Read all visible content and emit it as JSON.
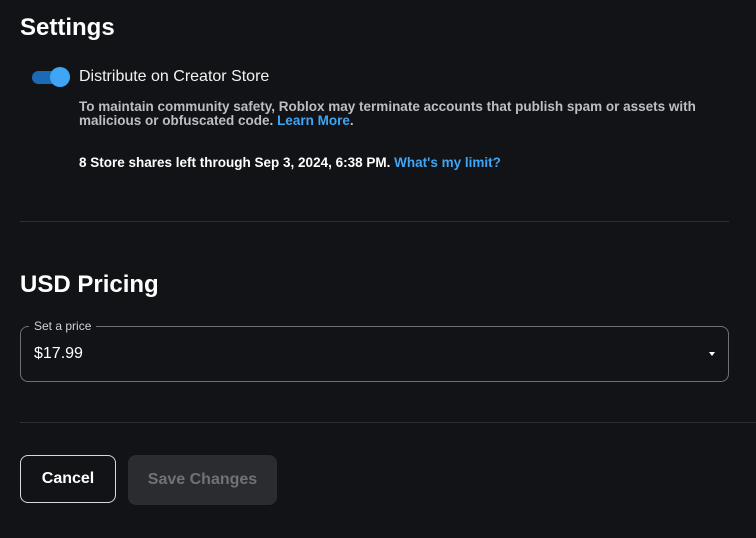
{
  "settings": {
    "title": "Settings",
    "distribute_toggle": {
      "label": "Distribute on Creator Store",
      "enabled": true
    },
    "safety_note": "To maintain community safety, Roblox may terminate accounts that publish spam or assets with malicious or obfuscated code.",
    "safety_link": "Learn More",
    "safety_period": ".",
    "shares_note": "8 Store shares left through Sep 3, 2024, 6:38 PM.",
    "shares_link": "What's my limit?"
  },
  "pricing": {
    "title": "USD Pricing",
    "select_label": "Set a price",
    "selected_value": "$17.99"
  },
  "actions": {
    "cancel_label": "Cancel",
    "save_label": "Save Changes",
    "save_disabled": true
  },
  "colors": {
    "background": "#121316",
    "accent": "#3ea6f5",
    "toggle_track": "#1a6bb3",
    "muted_text": "#bcbec2",
    "disabled_bg": "#2b2c30",
    "disabled_text": "#6f7277"
  }
}
